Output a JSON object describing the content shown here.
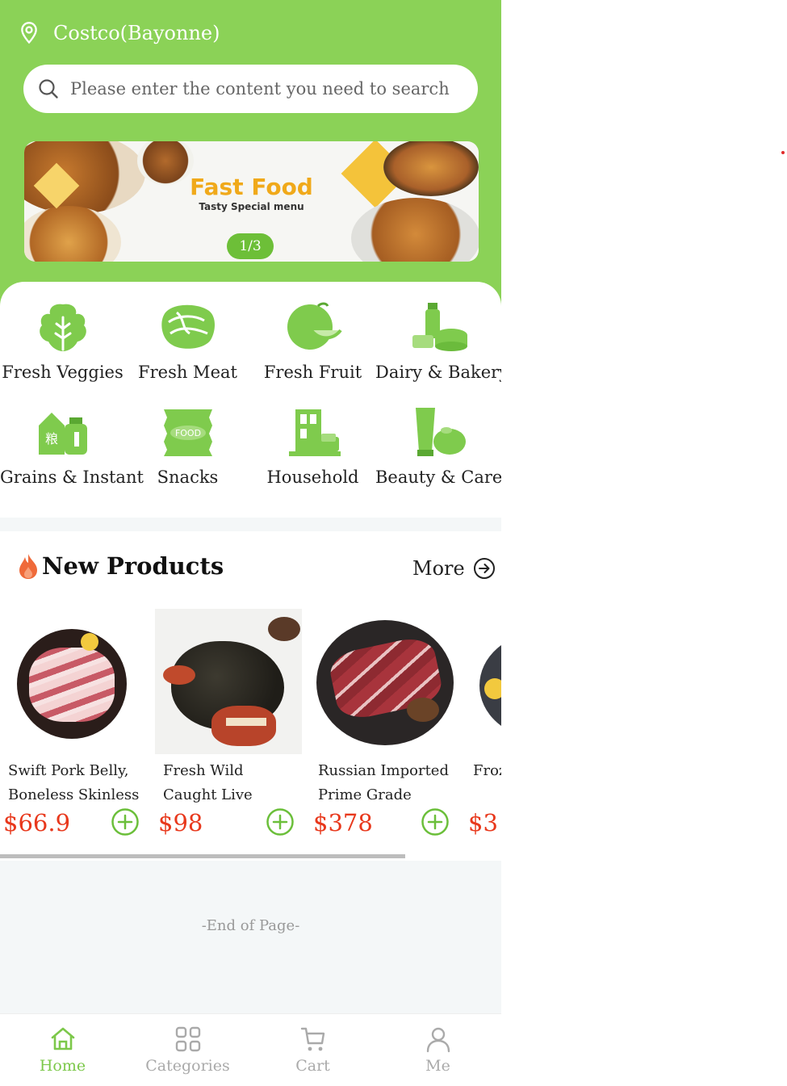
{
  "header": {
    "location": "Costco(Bayonne)",
    "search_placeholder": "Please enter the content you need to search for"
  },
  "banner": {
    "title": "Fast Food",
    "subtitle": "Tasty Special menu",
    "pager": "1/3"
  },
  "categories": [
    {
      "label": "Fresh Veggies",
      "icon": "vegetable-icon"
    },
    {
      "label": "Fresh Meat",
      "icon": "meat-icon"
    },
    {
      "label": "Fresh Fruit",
      "icon": "fruit-icon"
    },
    {
      "label": "Dairy & Bakery",
      "icon": "dairy-icon"
    },
    {
      "label": "Grains & Instant",
      "icon": "grains-icon"
    },
    {
      "label": "Snacks",
      "icon": "snacks-icon"
    },
    {
      "label": "Household",
      "icon": "household-icon"
    },
    {
      "label": "Beauty & Care",
      "icon": "beauty-icon"
    }
  ],
  "new_products": {
    "title": "New Products",
    "more_label": "More",
    "items": [
      {
        "name": "Swift Pork Belly, Boneless Skinless",
        "price": "$66.9"
      },
      {
        "name": "Fresh Wild Caught Live Lobsters",
        "price": "$98"
      },
      {
        "name": "Russian Imported Prime Grade Grain…",
        "price": "$378"
      },
      {
        "name": "Frozen …s, Fr",
        "price": "$3"
      }
    ]
  },
  "footer_text": "-End of Page-",
  "tabs": [
    {
      "label": "Home",
      "icon": "home-icon",
      "active": true
    },
    {
      "label": "Categories",
      "icon": "grid-icon",
      "active": false
    },
    {
      "label": "Cart",
      "icon": "cart-icon",
      "active": false
    },
    {
      "label": "Me",
      "icon": "user-icon",
      "active": false
    }
  ],
  "colors": {
    "brand_green": "#8bd257",
    "price_red": "#e8381c",
    "inactive_gray": "#aaaaaa"
  }
}
